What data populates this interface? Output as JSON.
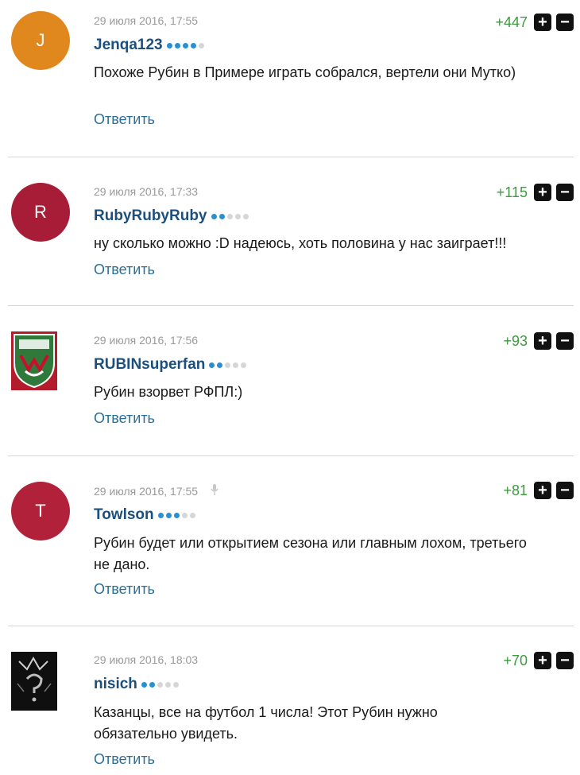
{
  "comments": [
    {
      "avatar_letter": "J",
      "avatar_color": "#e0871e",
      "date": "29 июля 2016, 17:55",
      "username": "Jenqa123",
      "level": 4,
      "text": "Похоже Рубин в Примере играть собрался, вертели они Мутко)",
      "reply_label": "Ответить",
      "score": "+447"
    },
    {
      "avatar_letter": "R",
      "avatar_color": "#a71c36",
      "date": "29 июля 2016, 17:33",
      "username": "RubyRubyRuby",
      "level": 2,
      "text": "ну сколько можно :D надеюсь, хоть половина у нас заиграет!!!",
      "reply_label": "Ответить",
      "score": "+115"
    },
    {
      "avatar_icon": "rubin-crest-icon",
      "date": "29 июля 2016, 17:56",
      "username": "RUBINsuperfan",
      "level": 2,
      "text": "Рубин взорвет РФПЛ:)",
      "reply_label": "Ответить",
      "score": "+93"
    },
    {
      "avatar_letter": "T",
      "avatar_color": "#b2213a",
      "date": "29 июля 2016, 17:55",
      "username": "Towlson",
      "level": 3,
      "text": "Рубин будет или открытием сезона или главным лохом, третьего не дано.",
      "reply_label": "Ответить",
      "score": "+81"
    },
    {
      "avatar_icon": "dark-sketch-icon",
      "date": "29 июля 2016, 18:03",
      "username": "nisich",
      "level": 2,
      "text": "Казанцы, все на футбол 1 числа! Этот Рубин нужно обязательно увидеть.",
      "reply_label": "Ответить",
      "score": "+70"
    }
  ],
  "vote_up_icon": "plus-icon",
  "vote_down_icon": "minus-icon"
}
